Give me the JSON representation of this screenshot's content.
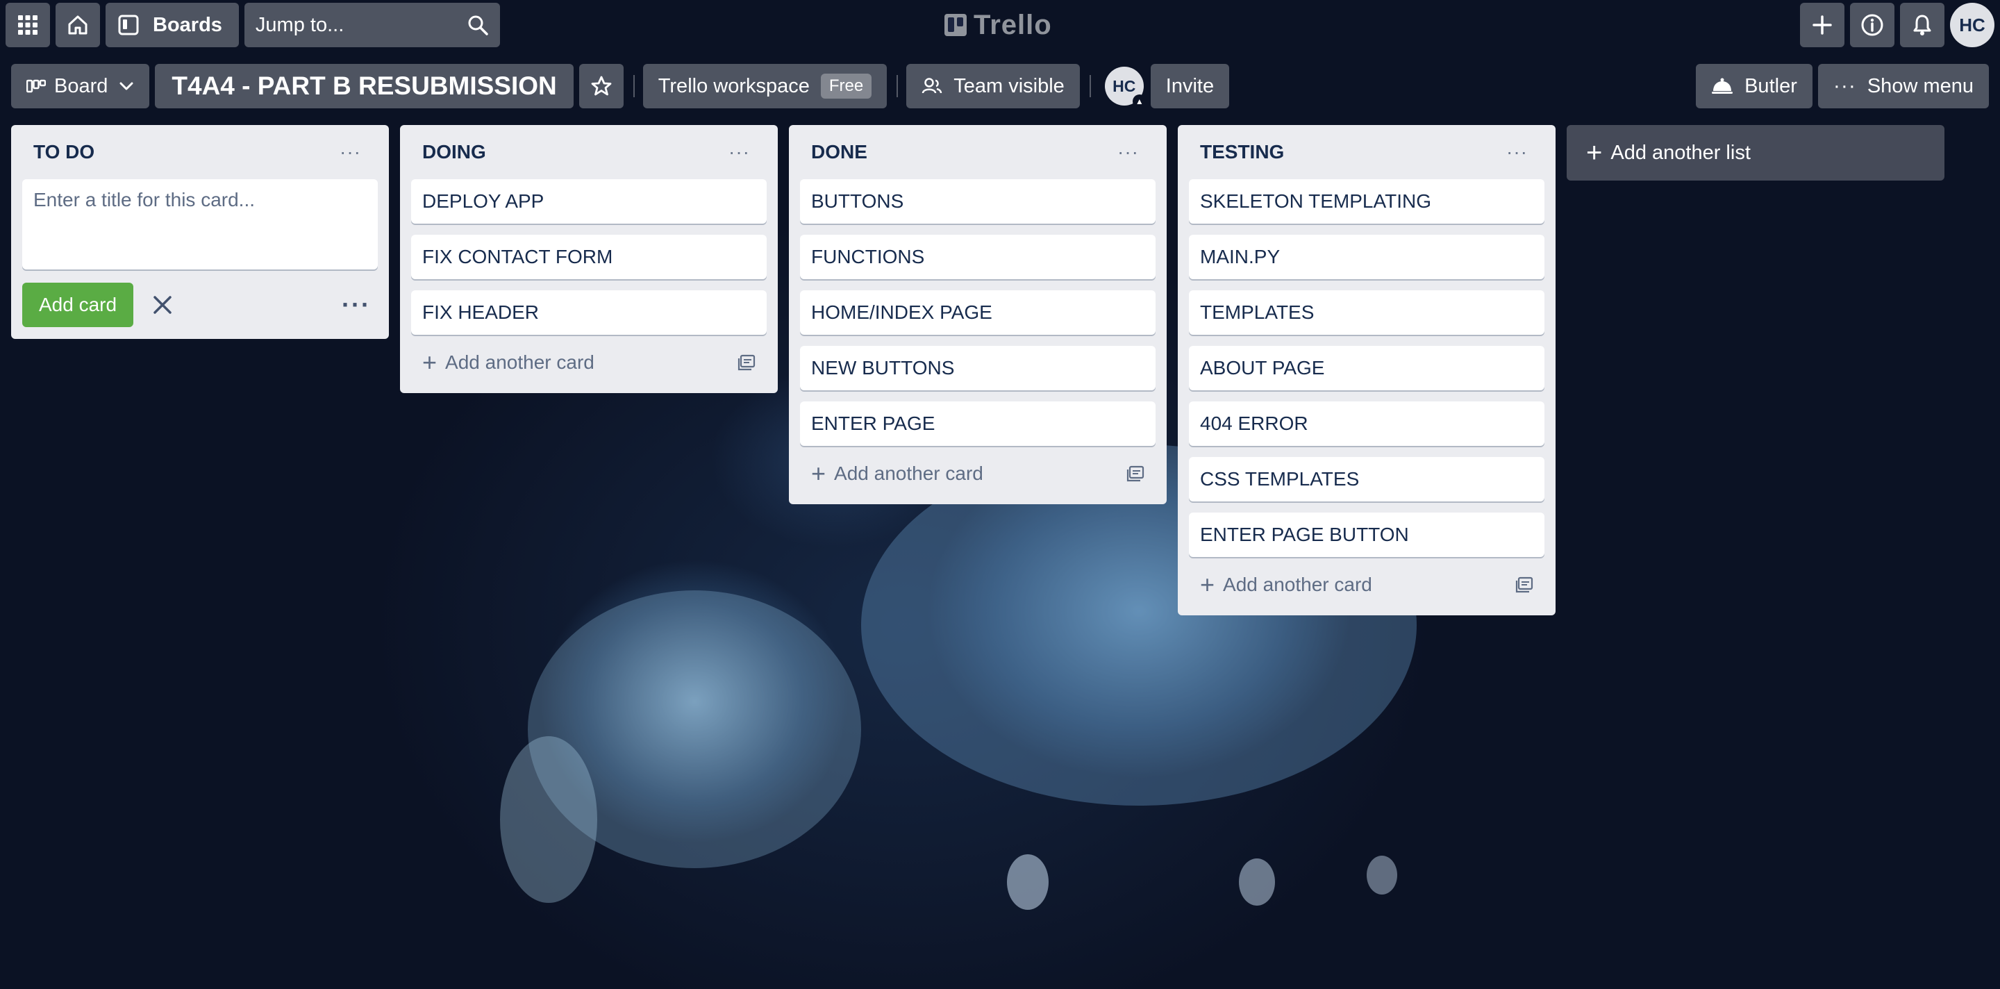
{
  "topbar": {
    "boards_label": "Boards",
    "search_placeholder": "Jump to...",
    "logo_text": "Trello",
    "user_initials": "HC"
  },
  "board": {
    "view_label": "Board",
    "title": "T4A4 - PART B RESUBMISSION",
    "workspace_label": "Trello workspace",
    "workspace_badge": "Free",
    "visibility_label": "Team visible",
    "member_initials": "HC",
    "invite_label": "Invite",
    "butler_label": "Butler",
    "show_menu_label": "Show menu"
  },
  "lists": [
    {
      "title": "TO DO",
      "composer_placeholder": "Enter a title for this card...",
      "add_card_button": "Add card",
      "cards": []
    },
    {
      "title": "DOING",
      "cards": [
        "DEPLOY APP",
        "FIX CONTACT FORM",
        "FIX HEADER"
      ],
      "add_label": "Add another card"
    },
    {
      "title": "DONE",
      "cards": [
        "BUTTONS",
        "FUNCTIONS",
        "HOME/INDEX PAGE",
        "NEW BUTTONS",
        "ENTER PAGE"
      ],
      "add_label": "Add another card"
    },
    {
      "title": "TESTING",
      "cards": [
        "SKELETON TEMPLATING",
        "MAIN.PY",
        "TEMPLATES",
        "ABOUT PAGE",
        "404 ERROR",
        "CSS TEMPLATES",
        "ENTER PAGE BUTTON"
      ],
      "add_label": "Add another card"
    }
  ],
  "add_list_label": "Add another list"
}
